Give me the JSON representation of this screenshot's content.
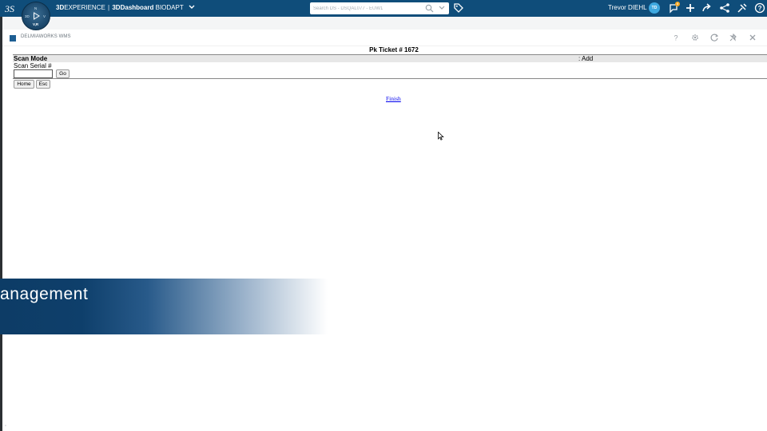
{
  "topbar": {
    "brand_bold": "3D",
    "brand_rest": "EXPERIENCE",
    "separator": "|",
    "brand_dash_bold": "3D",
    "brand_dash_rest": "Dashboard",
    "dashboard_name": "BIODAPT",
    "compass_labels": {
      "top": "N",
      "left": "3D",
      "right": "V",
      "bottom": "V,R"
    },
    "search_placeholder": "Search DS - DSQAL077 - EUW1",
    "user_name": "Trevor DIEHL",
    "user_initials": "TD",
    "notifications_badge": "8",
    "icons": [
      "ds-logo-icon",
      "compass-icon",
      "chevron-down-icon",
      "search-icon",
      "tag-icon",
      "notification-icon",
      "plus-icon",
      "share-icon",
      "network-icon",
      "tools-icon",
      "help-icon"
    ]
  },
  "widget": {
    "title": "DELMIAWORKS WMS",
    "icons": [
      "help-icon",
      "gear-icon",
      "refresh-icon",
      "pin-icon",
      "close-icon"
    ]
  },
  "wms": {
    "ticket": "Pk Ticket # 1672",
    "scan_mode": "Scan Mode",
    "mode_value": ": Add",
    "serial_label": "Scan Serial #",
    "serial_value": "",
    "go_label": "Go",
    "home_label": "Home",
    "esc_label": "Esc",
    "finish_label": "Finish"
  },
  "banner": {
    "text": "anagement"
  },
  "colors": {
    "topbar": "#0f4d7a",
    "accent": "#3fa9e0",
    "badge": "#f7a823",
    "link": "#0000ee"
  }
}
